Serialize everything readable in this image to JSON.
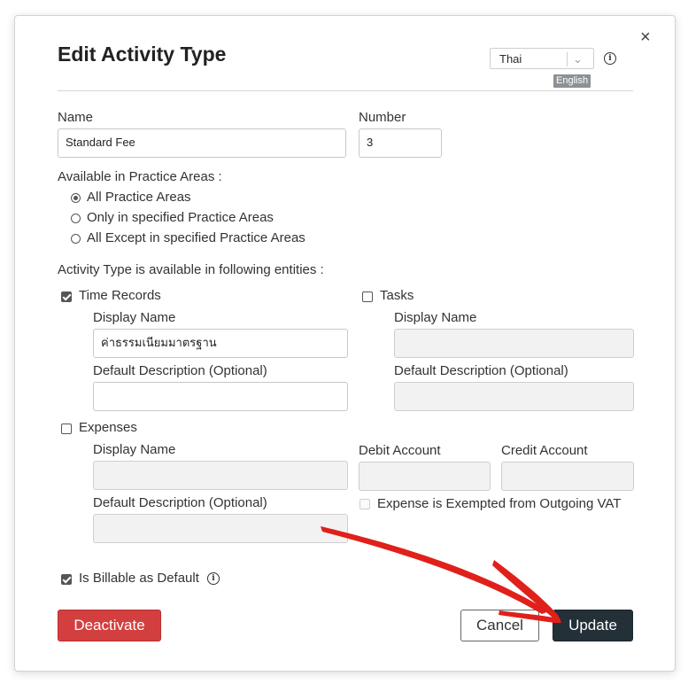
{
  "dialog": {
    "title": "Edit Activity Type",
    "close_glyph": "×",
    "language": {
      "selected": "Thai",
      "badge": "English",
      "info_glyph": "i"
    }
  },
  "fields": {
    "name_label": "Name",
    "name_value": "Standard Fee",
    "number_label": "Number",
    "number_value": "3"
  },
  "practice_areas": {
    "label": "Available in Practice Areas :",
    "options": [
      {
        "label": "All Practice Areas",
        "checked": true
      },
      {
        "label": "Only in specified Practice Areas",
        "checked": false
      },
      {
        "label": "All Except in specified Practice Areas",
        "checked": false
      }
    ]
  },
  "entities": {
    "label": "Activity Type is available in following entities :",
    "time_records": {
      "label": "Time Records",
      "checked": true,
      "display_name_label": "Display Name",
      "display_name_value": "ค่าธรรมเนียมมาตรฐาน",
      "default_desc_label": "Default Description (Optional)",
      "default_desc_value": ""
    },
    "tasks": {
      "label": "Tasks",
      "checked": false,
      "display_name_label": "Display Name",
      "default_desc_label": "Default Description (Optional)"
    },
    "expenses": {
      "label": "Expenses",
      "checked": false,
      "display_name_label": "Display Name",
      "debit_label": "Debit Account",
      "credit_label": "Credit Account",
      "default_desc_label": "Default Description (Optional)",
      "vat_label": "Expense is Exempted from Outgoing VAT"
    }
  },
  "billable": {
    "label": "Is Billable as Default",
    "checked": true,
    "info_glyph": "i"
  },
  "buttons": {
    "deactivate": "Deactivate",
    "cancel": "Cancel",
    "update": "Update"
  },
  "colors": {
    "deactivate": "#d33f3f",
    "update": "#243038",
    "annotation_arrow": "#e0201a"
  }
}
